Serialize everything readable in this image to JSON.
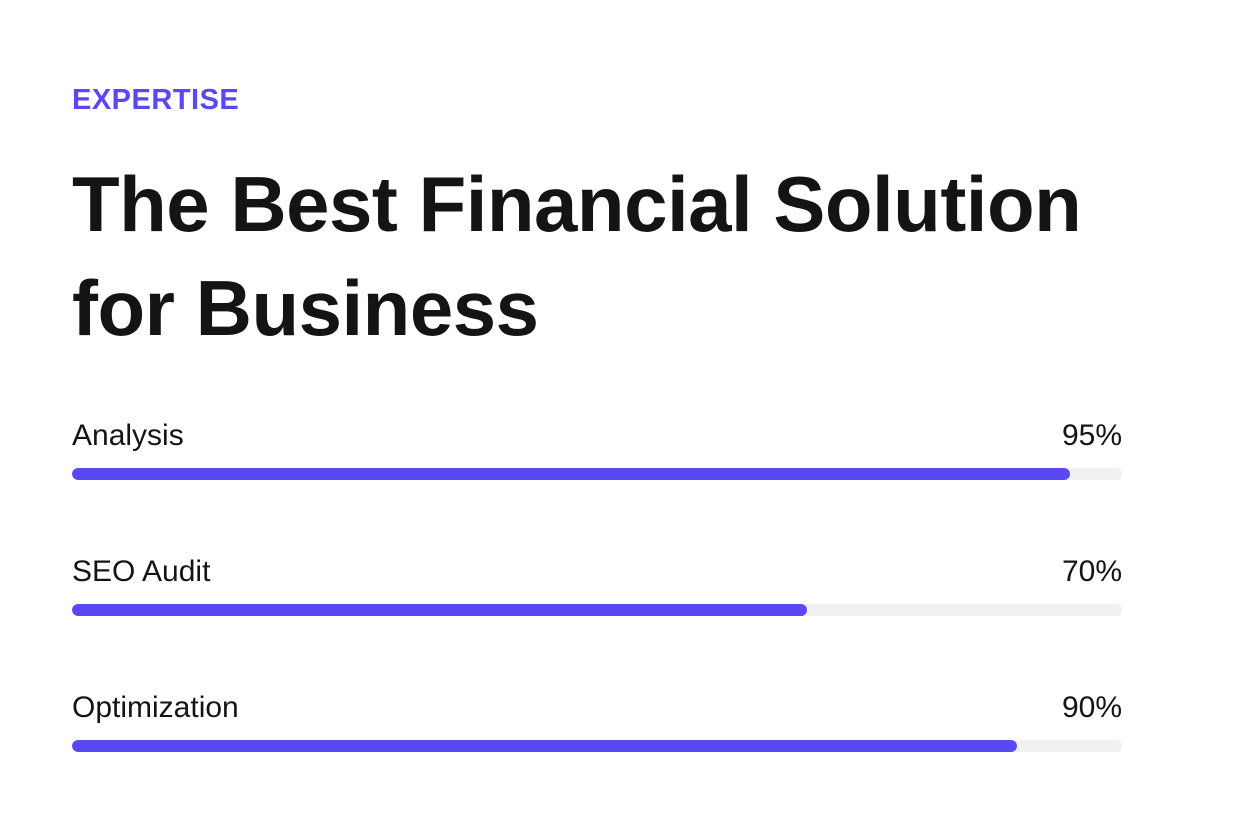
{
  "colors": {
    "accent": "#5b48f5",
    "text": "#141414",
    "track": "#f1f1f3",
    "background": "#ffffff"
  },
  "section": {
    "eyebrow": "EXPERTISE",
    "title_line_1": "The Best Financial Solution",
    "title_line_2": "for Business"
  },
  "skills": [
    {
      "label": "Analysis",
      "percent_text": "95%",
      "value": 95
    },
    {
      "label": "SEO Audit",
      "percent_text": "70%",
      "value": 70
    },
    {
      "label": "Optimization",
      "percent_text": "90%",
      "value": 90
    }
  ]
}
